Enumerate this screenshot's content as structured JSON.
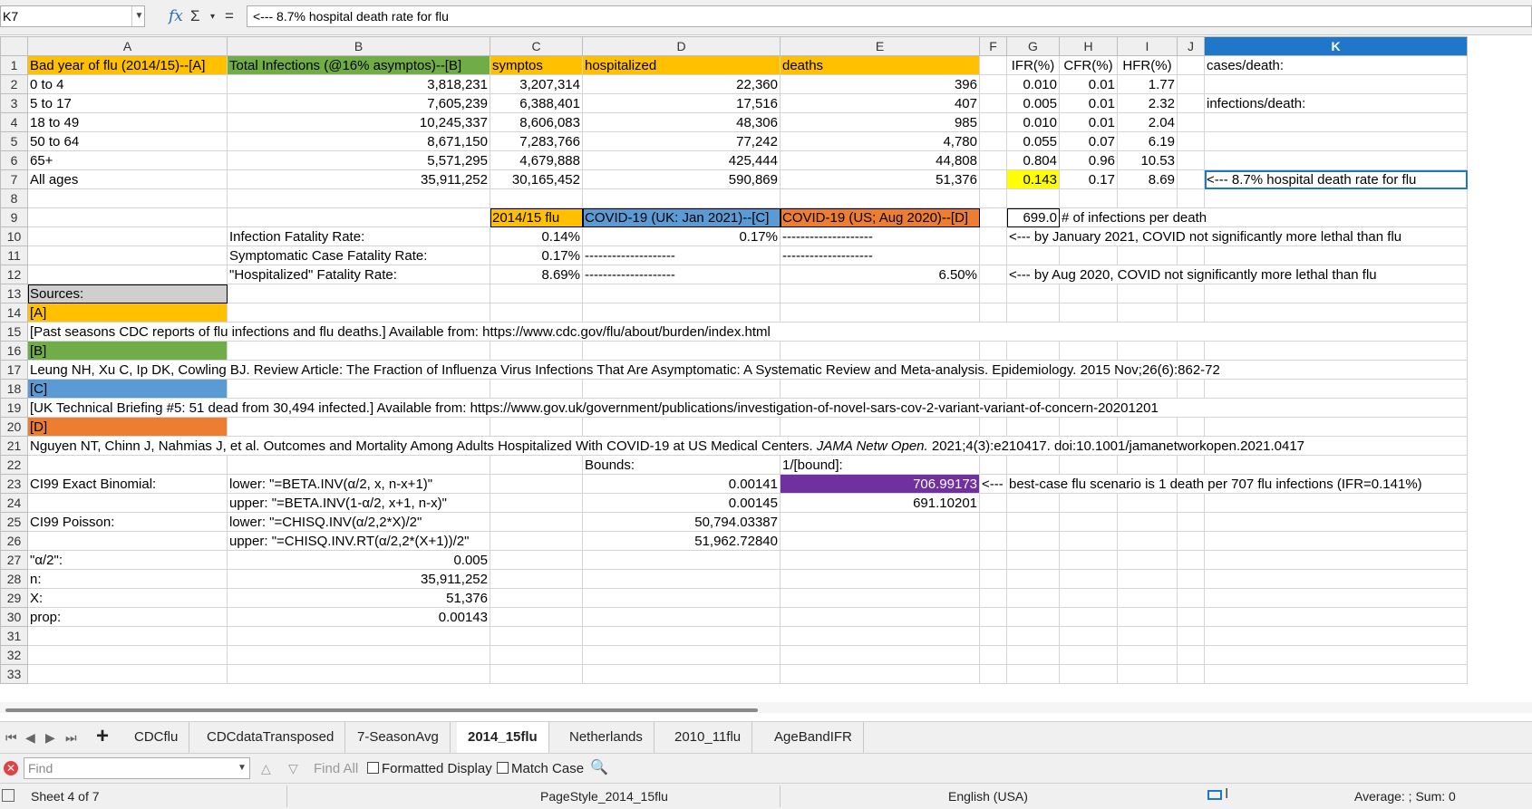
{
  "formula_bar": {
    "name_box": "K7",
    "fx": "fx",
    "sigma": "Σ",
    "sigma_dd": "▾",
    "equals": "=",
    "content": "<--- 8.7% hospital death rate for flu"
  },
  "columns": [
    "A",
    "B",
    "C",
    "D",
    "E",
    "F",
    "G",
    "H",
    "I",
    "J",
    "K"
  ],
  "rows": {
    "r1": {
      "n": "1",
      "A": "Bad year of flu (2014/15)--[A]",
      "B": "Total Infections (@16% asymptos)--[B]",
      "C": "symptos",
      "D": "hospitalized",
      "E": "deaths",
      "G": "IFR(%)",
      "H": "CFR(%)",
      "I": "HFR(%)",
      "K": "cases/death:"
    },
    "r2": {
      "n": "2",
      "A": "0 to 4",
      "B": "3,818,231",
      "C": "3,207,314",
      "D": "22,360",
      "E": "396",
      "G": "0.010",
      "H": "0.01",
      "I": "1.77"
    },
    "r3": {
      "n": "3",
      "A": "5 to 17",
      "B": "7,605,239",
      "C": "6,388,401",
      "D": "17,516",
      "E": "407",
      "G": "0.005",
      "H": "0.01",
      "I": "2.32",
      "K": "infections/death:"
    },
    "r4": {
      "n": "4",
      "A": "18 to 49",
      "B": "10,245,337",
      "C": "8,606,083",
      "D": "48,306",
      "E": "985",
      "G": "0.010",
      "H": "0.01",
      "I": "2.04"
    },
    "r5": {
      "n": "5",
      "A": "50 to 64",
      "B": "8,671,150",
      "C": "7,283,766",
      "D": "77,242",
      "E": "4,780",
      "G": "0.055",
      "H": "0.07",
      "I": "6.19"
    },
    "r6": {
      "n": "6",
      "A": "65+",
      "B": "5,571,295",
      "C": "4,679,888",
      "D": "425,444",
      "E": "44,808",
      "G": "0.804",
      "H": "0.96",
      "I": "10.53"
    },
    "r7": {
      "n": "7",
      "A": "All ages",
      "B": "35,911,252",
      "C": "30,165,452",
      "D": "590,869",
      "E": "51,376",
      "G": "0.143",
      "H": "0.17",
      "I": "8.69",
      "K": "<--- 8.7% hospital death rate for flu"
    },
    "r8": {
      "n": "8"
    },
    "r9": {
      "n": "9",
      "C": "2014/15 flu",
      "D": "COVID-19 (UK: Jan 2021)--[C]",
      "E": "COVID-19 (US; Aug 2020)--[D]",
      "G": "699.0",
      "H": "# of infections per death"
    },
    "r10": {
      "n": "10",
      "B": "Infection Fatality Rate:",
      "C": "0.14%",
      "D": "0.17%",
      "E": "--------------------",
      "G": "<--- by January 2021, COVID not significantly more lethal than flu"
    },
    "r11": {
      "n": "11",
      "B": "Symptomatic Case Fatality Rate:",
      "C": "0.17%",
      "D": "--------------------",
      "E": "--------------------"
    },
    "r12": {
      "n": "12",
      "B": "\"Hospitalized\" Fatality Rate:",
      "C": "8.69%",
      "D": "--------------------",
      "E": "6.50%",
      "G": "<--- by Aug 2020, COVID not significantly more lethal than flu"
    },
    "r13": {
      "n": "13",
      "A": "Sources:"
    },
    "r14": {
      "n": "14",
      "A": "[A]"
    },
    "r15": {
      "n": "15",
      "A": "[Past seasons CDC reports of flu infections and flu deaths.] Available from: https://www.cdc.gov/flu/about/burden/index.html"
    },
    "r16": {
      "n": "16",
      "A": "[B]"
    },
    "r17": {
      "n": "17",
      "A": "Leung NH, Xu C, Ip DK, Cowling BJ. Review Article: The Fraction of Influenza Virus Infections That Are Asymptomatic: A Systematic Review and Meta-analysis. Epidemiology. 2015 Nov;26(6):862-72"
    },
    "r18": {
      "n": "18",
      "A": "[C]"
    },
    "r19": {
      "n": "19",
      "A": "[UK Technical Briefing #5: 51 dead from 30,494 infected.] Available from: https://www.gov.uk/government/publications/investigation-of-novel-sars-cov-2-variant-variant-of-concern-20201201"
    },
    "r20": {
      "n": "20",
      "A": "[D]"
    },
    "r21": {
      "n": "21",
      "A_pre": "Nguyen NT, Chinn J, Nahmias J, et al. Outcomes and Mortality Among Adults Hospitalized With COVID-19 at US Medical Centers. ",
      "A_ital": "JAMA Netw Open.",
      "A_post": " 2021;4(3):e210417. doi:10.1001/jamanetworkopen.2021.0417"
    },
    "r22": {
      "n": "22",
      "D": "Bounds:",
      "E": "1/[bound]:"
    },
    "r23": {
      "n": "23",
      "A": "CI99 Exact Binomial:",
      "B": "lower: \"=BETA.INV(α/2, x, n-x+1)\"",
      "D": "0.00141",
      "E": "706.99173",
      "F": "<---",
      "G": "best-case flu scenario is 1 death per 707 flu infections (IFR=0.141%)"
    },
    "r24": {
      "n": "24",
      "B": "upper: \"=BETA.INV(1-α/2, x+1, n-x)\"",
      "D": "0.00145",
      "E": "691.10201"
    },
    "r25": {
      "n": "25",
      "A": "CI99 Poisson:",
      "B": "lower: \"=CHISQ.INV(α/2,2*X)/2\"",
      "D": "50,794.03387"
    },
    "r26": {
      "n": "26",
      "B": "upper: \"=CHISQ.INV.RT(α/2,2*(X+1))/2\"",
      "D": "51,962.72840"
    },
    "r27": {
      "n": "27",
      "A": "\"α/2\":",
      "B": "0.005"
    },
    "r28": {
      "n": "28",
      "A": "n:",
      "B": "35,911,252"
    },
    "r29": {
      "n": "29",
      "A": "X:",
      "B": "51,376"
    },
    "r30": {
      "n": "30",
      "A": "prop:",
      "B": "0.00143"
    },
    "r31": {
      "n": "31"
    },
    "r32": {
      "n": "32"
    },
    "r33": {
      "n": "33"
    }
  },
  "colors": {
    "orange": "#ffc000",
    "green": "#70ad47",
    "blue": "#5b9bd5",
    "dark_orange": "#ed7d31",
    "gray": "#d0cece",
    "yellow": "#ffff00",
    "purple": "#7030a0",
    "selection": "#1e77c9"
  },
  "sheet_tabs": [
    "CDCflu",
    "CDCdataTransposed",
    "7-SeasonAvg",
    "2014_15flu",
    "Netherlands",
    "2010_11flu",
    "AgeBandIFR"
  ],
  "active_tab": "2014_15flu",
  "find_bar": {
    "placeholder": "Find",
    "find_all": "Find All",
    "formatted_display": "Formatted Display",
    "match_case": "Match Case"
  },
  "status_bar": {
    "sheet": "Sheet 4 of 7",
    "page_style": "PageStyle_2014_15flu",
    "language": "English (USA)",
    "summary": "Average: ; Sum: 0"
  }
}
